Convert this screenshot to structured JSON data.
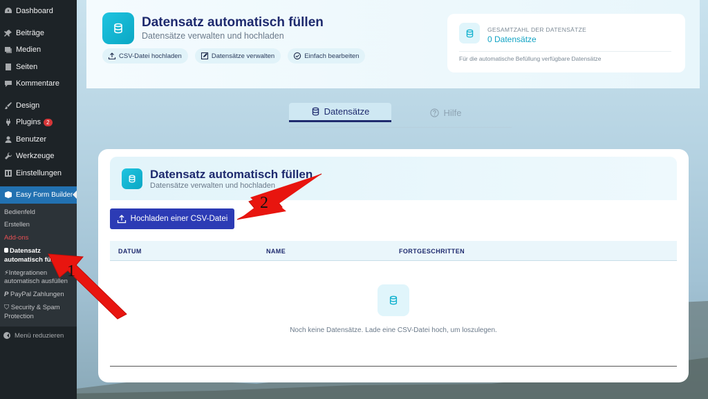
{
  "sidebar": {
    "items": [
      {
        "label": "Dashboard",
        "icon": "dashboard-icon"
      },
      {
        "label": "Beiträge",
        "icon": "pin-icon"
      },
      {
        "label": "Medien",
        "icon": "media-icon"
      },
      {
        "label": "Seiten",
        "icon": "page-icon"
      },
      {
        "label": "Kommentare",
        "icon": "comment-icon"
      },
      {
        "label": "Design",
        "icon": "brush-icon"
      },
      {
        "label": "Plugins",
        "icon": "plugin-icon",
        "badge": "2"
      },
      {
        "label": "Benutzer",
        "icon": "user-icon"
      },
      {
        "label": "Werkzeuge",
        "icon": "wrench-icon"
      },
      {
        "label": "Einstellungen",
        "icon": "settings-icon"
      },
      {
        "label": "Easy Form Builder",
        "icon": "form-builder-icon"
      }
    ],
    "submenu": [
      "Bedienfeld",
      "Erstellen",
      "Add-ons",
      "Datensatz automatisch füllen",
      "Integrationen automatisch ausfüllen",
      "PayPal Zahlungen",
      "Security & Spam Protection"
    ],
    "collapse_label": "Menü reduzieren"
  },
  "header": {
    "title": "Datensatz automatisch füllen",
    "subtitle": "Datensätze verwalten und hochladen",
    "pills": [
      "CSV-Datei hochladen",
      "Datensätze verwalten",
      "Einfach bearbeiten"
    ],
    "stat": {
      "label": "GESAMTZAHL DER DATENSÄTZE",
      "value": "0 Datensätze",
      "note": "Für die automatische Befüllung verfügbare Datensätze"
    }
  },
  "tabs": {
    "active": "Datensätze",
    "inactive": "Hilfe"
  },
  "card": {
    "title": "Datensatz automatisch füllen",
    "subtitle": "Datensätze verwalten und hochladen",
    "upload_button": "Hochladen einer CSV-Datei",
    "columns": [
      "DATUM",
      "NAME",
      "FORTGESCHRITTEN"
    ],
    "empty_message": "Noch keine Datensätze. Lade eine CSV-Datei hoch, um loszulegen."
  },
  "annotations": {
    "arrow_1_label": "1",
    "arrow_2_label": "2"
  },
  "colors": {
    "sidebar_bg": "#1d2327",
    "sidebar_active": "#2271b1",
    "accent": "#11b1ce",
    "title": "#1e2a6e",
    "button": "#2c3bb5",
    "arrow": "#e8150f"
  }
}
